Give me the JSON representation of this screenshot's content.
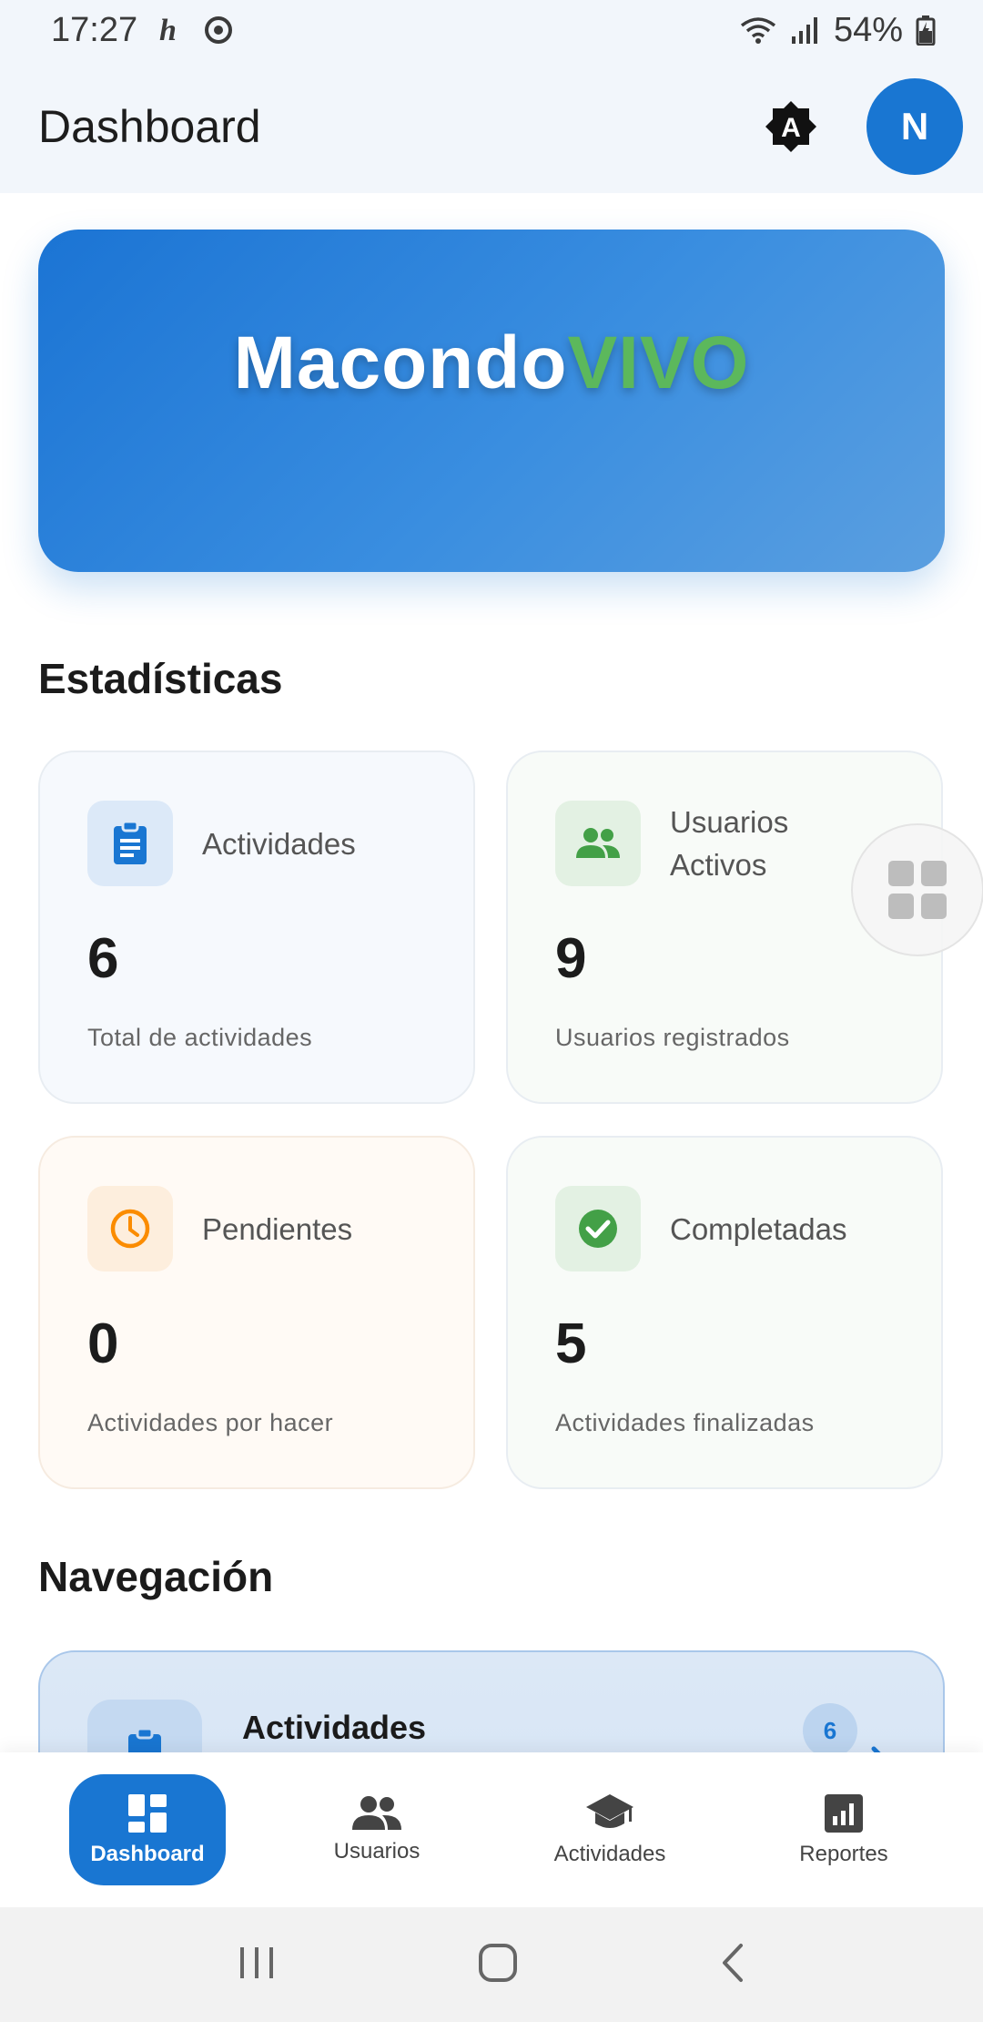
{
  "status_bar": {
    "time": "17:27",
    "battery": "54%",
    "icons": [
      "h-icon",
      "sync-icon",
      "wifi-icon",
      "signal-icon",
      "battery-icon"
    ]
  },
  "app_bar": {
    "title": "Dashboard",
    "avatar_initial": "N",
    "theme_icon": "auto-brightness-icon"
  },
  "banner": {
    "brand_part1": "Macondo",
    "brand_part2": "VIVO"
  },
  "stats": {
    "title": "Estadísticas",
    "cards": [
      {
        "label": "Actividades",
        "value": "6",
        "subtitle": "Total de actividades",
        "icon": "clipboard-icon",
        "color": "#1976d2"
      },
      {
        "label": "Usuarios Activos",
        "value": "9",
        "subtitle": "Usuarios registrados",
        "icon": "people-icon",
        "color": "#43a047"
      },
      {
        "label": "Pendientes",
        "value": "0",
        "subtitle": "Actividades por hacer",
        "icon": "clock-icon",
        "color": "#fb8c00"
      },
      {
        "label": "Completadas",
        "value": "5",
        "subtitle": "Actividades finalizadas",
        "icon": "check-circle-icon",
        "color": "#43a047"
      }
    ]
  },
  "navigation": {
    "title": "Navegación",
    "items": [
      {
        "label": "Actividades",
        "badge": "6",
        "icon": "clipboard-icon"
      }
    ]
  },
  "bottom_nav": {
    "tabs": [
      {
        "label": "Dashboard",
        "icon": "dashboard-icon",
        "active": true
      },
      {
        "label": "Usuarios",
        "icon": "people-icon",
        "active": false
      },
      {
        "label": "Actividades",
        "icon": "school-icon",
        "active": false
      },
      {
        "label": "Reportes",
        "icon": "bar-chart-icon",
        "active": false
      }
    ]
  },
  "colors": {
    "primary": "#1976d2",
    "accent_green": "#5cb85c",
    "orange": "#fb8c00"
  }
}
